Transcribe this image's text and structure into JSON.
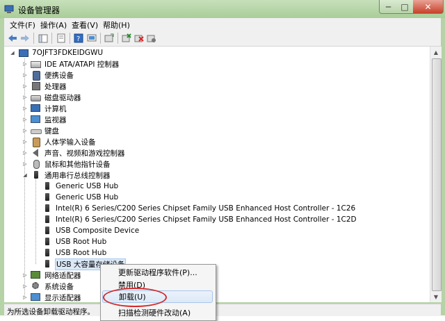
{
  "window": {
    "title": "设备管理器",
    "controls": {
      "minimize": "─",
      "maximize": "□",
      "close": "✕"
    }
  },
  "menu": {
    "items": [
      "文件(F)",
      "操作(A)",
      "查看(V)",
      "帮助(H)"
    ]
  },
  "toolbar": {
    "buttons": [
      "back-icon",
      "forward-icon",
      "show-hide-console-tree-icon",
      "properties-icon",
      "help-icon",
      "scan-hardware-icon",
      "update-driver-icon",
      "uninstall-icon",
      "disable-icon",
      "enable-icon"
    ]
  },
  "tree": {
    "root": "7OJFT3FDKEIDGWU",
    "nodes": [
      {
        "label": "IDE ATA/ATAPI 控制器",
        "icon": "ide-controller-icon"
      },
      {
        "label": "便携设备",
        "icon": "portable-device-icon"
      },
      {
        "label": "处理器",
        "icon": "processor-icon"
      },
      {
        "label": "磁盘驱动器",
        "icon": "disk-drive-icon"
      },
      {
        "label": "计算机",
        "icon": "computer-icon"
      },
      {
        "label": "监视器",
        "icon": "monitor-icon"
      },
      {
        "label": "键盘",
        "icon": "keyboard-icon"
      },
      {
        "label": "人体学输入设备",
        "icon": "hid-icon"
      },
      {
        "label": "声音、视频和游戏控制器",
        "icon": "sound-icon"
      },
      {
        "label": "鼠标和其他指针设备",
        "icon": "mouse-icon"
      },
      {
        "label": "通用串行总线控制器",
        "icon": "usb-controller-icon",
        "expanded": true
      },
      {
        "label": "网络适配器",
        "icon": "network-adapter-icon"
      },
      {
        "label": "系统设备",
        "icon": "system-device-icon"
      },
      {
        "label": "显示适配器",
        "icon": "display-adapter-icon"
      }
    ],
    "usb_children": [
      "Generic USB Hub",
      "Generic USB Hub",
      "Intel(R) 6 Series/C200 Series Chipset Family USB Enhanced Host Controller - 1C26",
      "Intel(R) 6 Series/C200 Series Chipset Family USB Enhanced Host Controller - 1C2D",
      "USB Composite Device",
      "USB Root Hub",
      "USB Root Hub",
      "USB 大容量存储设备"
    ],
    "selected": "USB 大容量存储设备"
  },
  "context_menu": {
    "items": [
      "更新驱动程序软件(P)...",
      "禁用(D)",
      "卸载(U)",
      "扫描检测硬件改动(A)"
    ],
    "highlighted": "卸载(U)"
  },
  "statusbar": {
    "text": "为所选设备卸载驱动程序。"
  },
  "colors": {
    "frame": "#b5d3a6",
    "highlight_ring": "#d42b2b",
    "selection": "#dbe8f7"
  }
}
